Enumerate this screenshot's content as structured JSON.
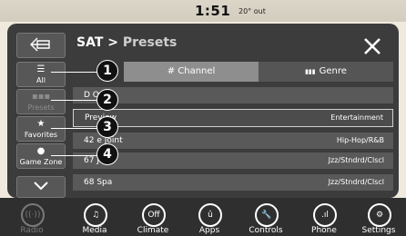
{
  "status": {
    "time": "1:51",
    "temp": "20° out"
  },
  "header": {
    "title": "SAT",
    "separator": " > ",
    "subtitle": "Presets"
  },
  "side_buttons": [
    {
      "id": "all",
      "icon": "☰",
      "label": "All"
    },
    {
      "id": "presets",
      "icon": "▪▪▪",
      "label": "Presets"
    },
    {
      "id": "favorites",
      "icon": "★",
      "label": "Favorites"
    },
    {
      "id": "gamezone",
      "icon": "●",
      "label": "Game Zone"
    }
  ],
  "tabs": [
    {
      "label": "# Channel"
    },
    {
      "label": "Genre",
      "icon": "▮▮▮"
    }
  ],
  "rows": [
    {
      "name": "D        O ID",
      "genre": ""
    },
    {
      "name": "Preview",
      "genre": "Entertainment"
    },
    {
      "name": "42       e Joint",
      "genre": "Hip-Hop/R&B"
    },
    {
      "name": "67        Jazz",
      "genre": "Jzz/Stndrd/Clscl"
    },
    {
      "name": "68 Spa",
      "genre": "Jzz/Stndrd/Clscl"
    }
  ],
  "callouts": [
    "1",
    "2",
    "3",
    "4"
  ],
  "bottom_bar": [
    {
      "label": "Radio",
      "icon": "((·))"
    },
    {
      "label": "Media",
      "icon": "♫"
    },
    {
      "label": "Climate",
      "icon": "Off"
    },
    {
      "label": "Apps",
      "icon": "û"
    },
    {
      "label": "Controls",
      "icon": "🔧"
    },
    {
      "label": "Phone",
      "icon": ".ıl"
    },
    {
      "label": "Settings",
      "icon": "⚙"
    }
  ],
  "colors": {
    "panel": "#3c3c3c",
    "tab_active": "#8e8e8e",
    "row": "#595959",
    "bar": "#2f2f2f"
  }
}
